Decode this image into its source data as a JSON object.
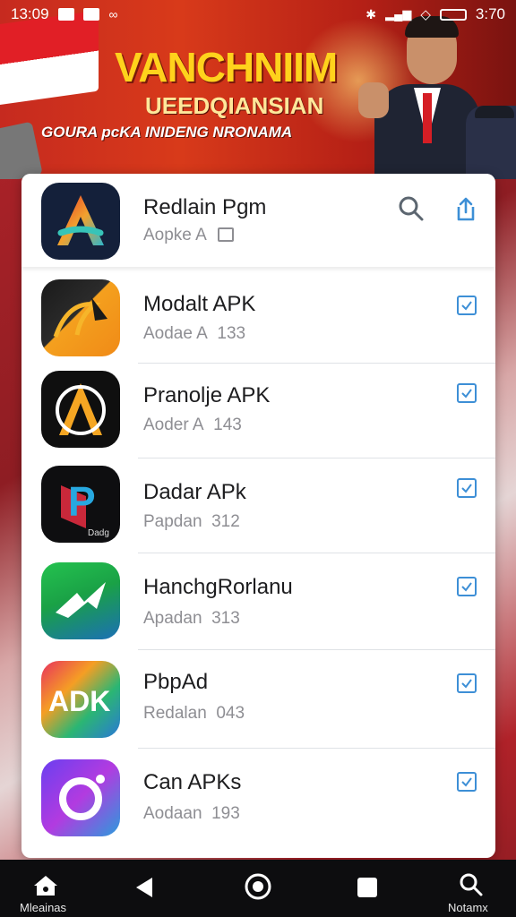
{
  "status_bar": {
    "time": "13:09",
    "right_time": "3:70"
  },
  "banner": {
    "title": "VANCHNIIM",
    "subtitle": "UEEDQIANSIAN",
    "tagline": "GOURA pcKA INIDENG NRONAMA"
  },
  "header_app": {
    "name": "Redlain Pgm",
    "meta": "Aopke A",
    "icon": "a-icon-gradient"
  },
  "apps": [
    {
      "name": "Modalt APK",
      "meta": "Aodae A",
      "count": "133",
      "icon": "yellow-brush-icon",
      "checked": true
    },
    {
      "name": "Pranolje APK",
      "meta": "Aoder A",
      "count": "143",
      "icon": "black-a-icon",
      "checked": true
    },
    {
      "name": "Dadar APk",
      "meta": "Papdan",
      "count": "312",
      "icon": "p-letter-icon",
      "checked": true
    },
    {
      "name": "HanchgRorlanu",
      "meta": "Apadan",
      "count": "313",
      "icon": "green-bolt-icon",
      "checked": true
    },
    {
      "name": "PbpAd",
      "meta": "Redalan",
      "count": "043",
      "icon": "adk-gradient-icon",
      "checked": true
    },
    {
      "name": "Can APKs",
      "meta": "Aodaan",
      "count": "193",
      "icon": "purple-ring-icon",
      "checked": true
    }
  ],
  "icon_text": {
    "p_sub": "Dadg",
    "adk": "ADK"
  },
  "navbar": {
    "home_label": "Mleainas",
    "search_label": "Notamx"
  },
  "colors": {
    "accent": "#3d8fd6",
    "banner_red": "#c62a1f",
    "banner_yellow": "#ffd21c"
  }
}
